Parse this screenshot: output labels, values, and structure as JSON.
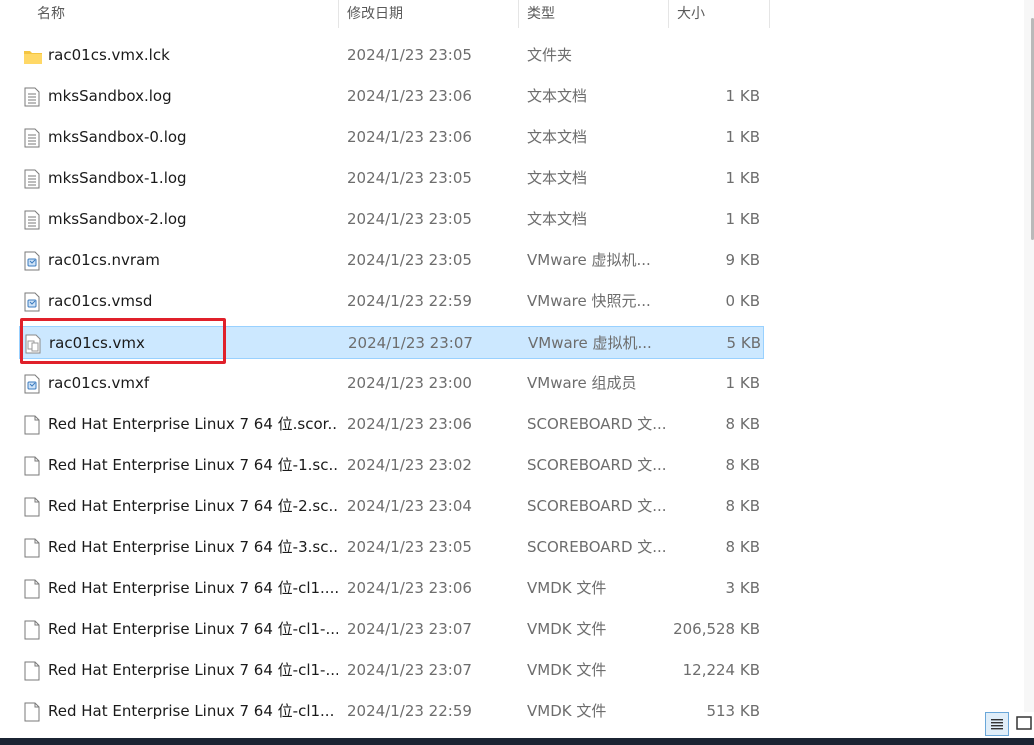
{
  "columns": {
    "name": "名称",
    "modified": "修改日期",
    "type": "类型",
    "size": "大小"
  },
  "files": [
    {
      "name": "rac01cs.vmx.lck",
      "date": "2024/1/23 23:05",
      "type": "文件夹",
      "size": "",
      "icon": "folder-icon"
    },
    {
      "name": "mksSandbox.log",
      "date": "2024/1/23 23:06",
      "type": "文本文档",
      "size": "1 KB",
      "icon": "text-file-icon"
    },
    {
      "name": "mksSandbox-0.log",
      "date": "2024/1/23 23:06",
      "type": "文本文档",
      "size": "1 KB",
      "icon": "text-file-icon"
    },
    {
      "name": "mksSandbox-1.log",
      "date": "2024/1/23 23:05",
      "type": "文本文档",
      "size": "1 KB",
      "icon": "text-file-icon"
    },
    {
      "name": "mksSandbox-2.log",
      "date": "2024/1/23 23:05",
      "type": "文本文档",
      "size": "1 KB",
      "icon": "text-file-icon"
    },
    {
      "name": "rac01cs.nvram",
      "date": "2024/1/23 23:05",
      "type": "VMware 虚拟机...",
      "size": "9 KB",
      "icon": "vmware-file-icon"
    },
    {
      "name": "rac01cs.vmsd",
      "date": "2024/1/23 22:59",
      "type": "VMware 快照元...",
      "size": "0 KB",
      "icon": "vmware-file-icon"
    },
    {
      "name": "rac01cs.vmx",
      "date": "2024/1/23 23:07",
      "type": "VMware 虚拟机...",
      "size": "5 KB",
      "icon": "vmx-file-icon",
      "selected": true
    },
    {
      "name": "rac01cs.vmxf",
      "date": "2024/1/23 23:00",
      "type": "VMware 组成员",
      "size": "1 KB",
      "icon": "vmware-file-icon"
    },
    {
      "name": "Red Hat Enterprise Linux 7 64 位.scor...",
      "date": "2024/1/23 23:06",
      "type": "SCOREBOARD 文...",
      "size": "8 KB",
      "icon": "blank-file-icon"
    },
    {
      "name": "Red Hat Enterprise Linux 7 64 位-1.sc...",
      "date": "2024/1/23 23:02",
      "type": "SCOREBOARD 文...",
      "size": "8 KB",
      "icon": "blank-file-icon"
    },
    {
      "name": "Red Hat Enterprise Linux 7 64 位-2.sc...",
      "date": "2024/1/23 23:04",
      "type": "SCOREBOARD 文...",
      "size": "8 KB",
      "icon": "blank-file-icon"
    },
    {
      "name": "Red Hat Enterprise Linux 7 64 位-3.sc...",
      "date": "2024/1/23 23:05",
      "type": "SCOREBOARD 文...",
      "size": "8 KB",
      "icon": "blank-file-icon"
    },
    {
      "name": "Red Hat Enterprise Linux 7 64 位-cl1....",
      "date": "2024/1/23 23:06",
      "type": "VMDK 文件",
      "size": "3 KB",
      "icon": "blank-file-icon"
    },
    {
      "name": "Red Hat Enterprise Linux 7 64 位-cl1-...",
      "date": "2024/1/23 23:07",
      "type": "VMDK 文件",
      "size": "206,528 KB",
      "icon": "blank-file-icon"
    },
    {
      "name": "Red Hat Enterprise Linux 7 64 位-cl1-...",
      "date": "2024/1/23 23:07",
      "type": "VMDK 文件",
      "size": "12,224 KB",
      "icon": "blank-file-icon"
    },
    {
      "name": "Red Hat Enterprise Linux 7 64 位-cl1...",
      "date": "2024/1/23 22:59",
      "type": "VMDK 文件",
      "size": "513 KB",
      "icon": "blank-file-icon"
    }
  ],
  "colors": {
    "selection_bg": "#cce8ff",
    "selection_border": "#99d1ff",
    "highlight_box": "#e0202a",
    "folder": "#f4c542"
  }
}
